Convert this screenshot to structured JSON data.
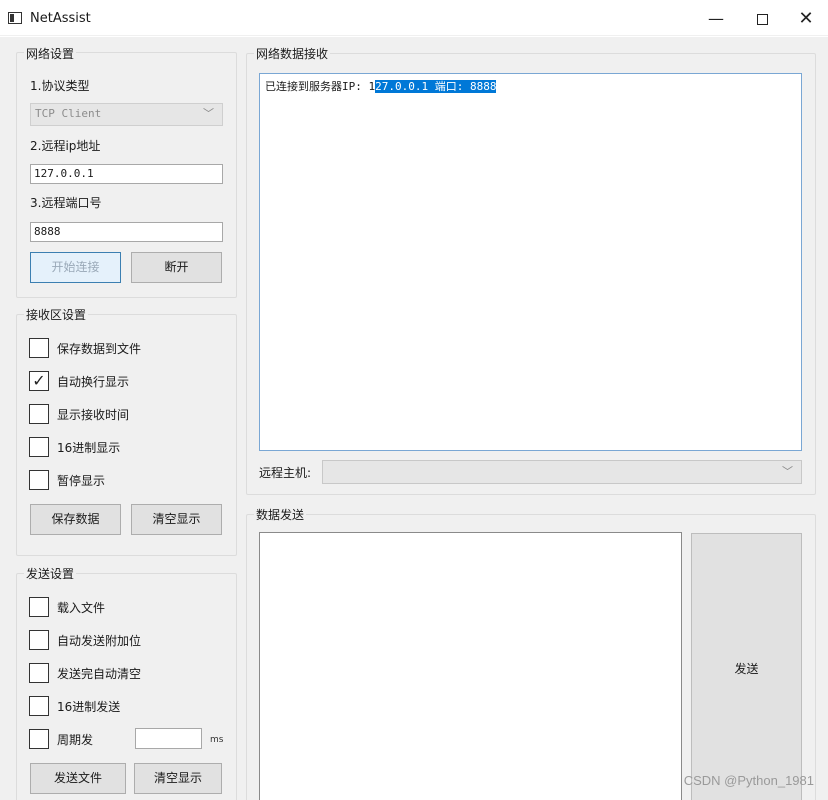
{
  "window": {
    "title": "NetAssist",
    "minimize": "—",
    "close": "✕"
  },
  "network_settings": {
    "title": "网络设置",
    "protocol_label": "1.协议类型",
    "protocol_value": "TCP Client",
    "ip_label": "2.远程ip地址",
    "ip_value": "127.0.0.1",
    "port_label": "3.远程端口号",
    "port_value": "8888",
    "connect_button": "开始连接",
    "disconnect_button": "断开"
  },
  "receive_settings": {
    "title": "接收区设置",
    "options": [
      {
        "label": "保存数据到文件",
        "checked": false
      },
      {
        "label": "自动换行显示",
        "checked": true
      },
      {
        "label": "显示接收时间",
        "checked": false
      },
      {
        "label": "16进制显示",
        "checked": false
      },
      {
        "label": "暂停显示",
        "checked": false
      }
    ],
    "save_button": "保存数据",
    "clear_button": "清空显示"
  },
  "send_settings": {
    "title": "发送设置",
    "options": [
      {
        "label": "载入文件",
        "checked": false
      },
      {
        "label": "自动发送附加位",
        "checked": false
      },
      {
        "label": "发送完自动清空",
        "checked": false
      },
      {
        "label": "16进制发送",
        "checked": false
      },
      {
        "label": "周期发",
        "checked": false
      }
    ],
    "period_value": "",
    "period_unit": "ms",
    "send_file_button": "发送文件",
    "clear_button": "清空显示"
  },
  "receive_area": {
    "title": "网络数据接收",
    "text_prefix": "已连接到服务器IP: 1",
    "text_selected": "27.0.0.1 端口: 8888",
    "remote_host_label": "远程主机:",
    "remote_host_value": ""
  },
  "send_area": {
    "title": "数据发送",
    "send_button": "发送"
  },
  "watermark": "CSDN @Python_1981"
}
